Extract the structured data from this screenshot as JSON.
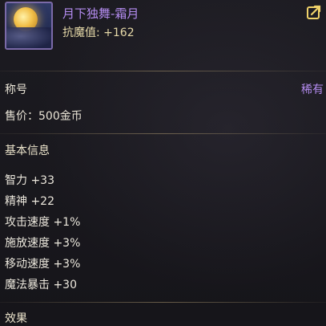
{
  "item": {
    "name": "月下独舞-霜月",
    "stat": "抗魔值: +162",
    "category": "称号",
    "rarity": "稀有",
    "price": "售价：500金币"
  },
  "sections": {
    "basic": "基本信息",
    "effect": "效果"
  },
  "attributes": [
    "智力 +33",
    "精神 +22",
    "攻击速度 +1%",
    "施放速度 +3%",
    "移动速度 +3%",
    "魔法暴击 +30"
  ],
  "colors": {
    "rarity": "#b48cf0",
    "stat": "#e6d9a8",
    "background": "#17161b"
  },
  "icons": {
    "item": "moon-night-icon",
    "share": "share-icon"
  }
}
